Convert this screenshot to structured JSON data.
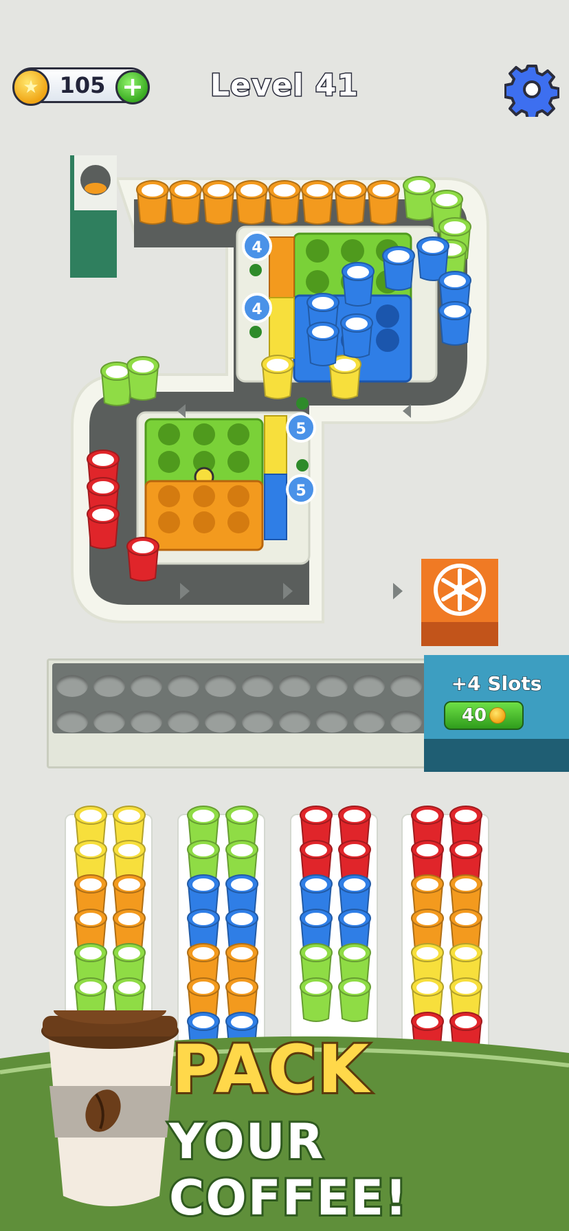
{
  "hud": {
    "coins": "105",
    "level_title": "Level 41",
    "coin_icon": "coin-star-icon",
    "add_icon": "plus-icon",
    "settings_icon": "gear-icon"
  },
  "board": {
    "tray_counters": [
      "4",
      "4",
      "5",
      "5"
    ],
    "dispenser_icon": "cup-dispenser-icon",
    "packer_icon": "fan-icon",
    "conveyor_arrows": [
      "arrow-left-icon",
      "arrow-right-icon"
    ],
    "queue_cups": [
      "orange",
      "orange",
      "orange",
      "orange",
      "orange",
      "orange",
      "orange",
      "orange",
      "green",
      "green",
      "green",
      "green",
      "blue",
      "blue",
      "blue",
      "yellow",
      "yellow",
      "green",
      "green",
      "red",
      "red",
      "red",
      "red"
    ]
  },
  "slots": {
    "label": "+4 Slots",
    "price": "40",
    "count": 22
  },
  "columns": [
    {
      "rows": [
        [
          "yellow",
          "yellow"
        ],
        [
          "yellow",
          "yellow"
        ],
        [
          "orange",
          "orange"
        ],
        [
          "orange",
          "orange"
        ],
        [
          "green",
          "green"
        ],
        [
          "green",
          "green"
        ]
      ]
    },
    {
      "rows": [
        [
          "green",
          "green"
        ],
        [
          "green",
          "green"
        ],
        [
          "blue",
          "blue"
        ],
        [
          "blue",
          "blue"
        ],
        [
          "orange",
          "orange"
        ],
        [
          "orange",
          "orange"
        ],
        [
          "blue",
          "blue"
        ]
      ]
    },
    {
      "rows": [
        [
          "red",
          "red"
        ],
        [
          "red",
          "red"
        ],
        [
          "blue",
          "blue"
        ],
        [
          "blue",
          "blue"
        ],
        [
          "green",
          "green"
        ],
        [
          "green",
          "green"
        ]
      ]
    },
    {
      "rows": [
        [
          "red",
          "red"
        ],
        [
          "red",
          "red"
        ],
        [
          "orange",
          "orange"
        ],
        [
          "orange",
          "orange"
        ],
        [
          "yellow",
          "yellow"
        ],
        [
          "yellow",
          "yellow"
        ],
        [
          "red",
          "red"
        ]
      ]
    }
  ],
  "banner": {
    "line1": "PACK",
    "line2": "YOUR COFFEE!"
  },
  "colors": {
    "orange": "#f39a1e",
    "green": "#8fdc45",
    "blue": "#2f7ee6",
    "yellow": "#f7df3c",
    "red": "#e0252a",
    "conveyor": "#555a58",
    "banner_green": "#5f8f3a"
  }
}
